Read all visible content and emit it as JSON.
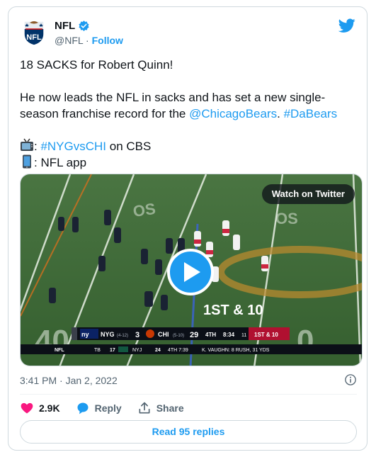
{
  "account": {
    "name": "NFL",
    "handle": "@NFL",
    "separator": "·",
    "follow_label": "Follow",
    "logo_text": "NFL"
  },
  "tweet": {
    "line1": "18 SACKS for Robert Quinn!",
    "line2_prefix": "He now leads the NFL in sacks and has set a new single-season franchise record for the ",
    "mention": "@ChicagoBears",
    "line2_mid": ". ",
    "hashtag1": "#DaBears",
    "tv_prefix": ": ",
    "hashtag2": "#NYGvsCHI",
    "tv_suffix": " on CBS",
    "app_text": ": NFL app"
  },
  "media": {
    "watch_label": "Watch on Twitter",
    "down_distance_overlay": "1ST & 10",
    "yard_number_left": "40",
    "yard_number_right": "0",
    "scorebug": {
      "away_team": "NYG",
      "away_record": "(4-12)",
      "away_score": "3",
      "home_team": "CHI",
      "home_record": "(5-10)",
      "home_score": "29",
      "quarter": "4TH",
      "clock": "8:34",
      "play_clock": "11",
      "down": "1ST & 10"
    },
    "ticker": {
      "league": "NFL",
      "team1": "TB",
      "team1_score": "17",
      "team2": "NYJ",
      "team2_score": "24",
      "status": "4TH 7:39",
      "note": "K. VAUGHN: 8 RUSH, 31 YDS"
    }
  },
  "meta": {
    "timestamp": "3:41 PM · Jan 2, 2022"
  },
  "actions": {
    "likes": "2.9K",
    "reply_label": "Reply",
    "share_label": "Share",
    "read_replies_label": "Read 95 replies"
  },
  "colors": {
    "accent": "#1d9bf0",
    "like": "#f91880",
    "text_secondary": "#536471",
    "field": "#3f6a35"
  }
}
